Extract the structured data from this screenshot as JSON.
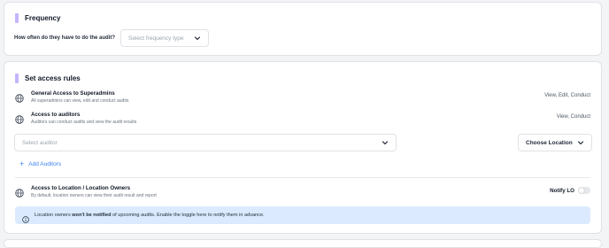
{
  "frequency": {
    "title": "Frequency",
    "question": "How often do they have to do the audit?",
    "select_placeholder": "Select frequency type"
  },
  "access": {
    "title": "Set access rules",
    "rules": [
      {
        "title": "General Access to Superadmins",
        "description": "All superadmins can view, edit and conduct audits",
        "permissions": "View, Edit, Conduct"
      },
      {
        "title": "Access to auditors",
        "description": "Auditors can conduct audits and view the audit results",
        "permissions": "View, Conduct"
      }
    ],
    "auditor_select_placeholder": "Select auditor",
    "location_select_label": "Choose Location",
    "add_auditors_label": "Add Auditors",
    "location_rule": {
      "title": "Access to Location / Location Owners",
      "description": "By default, location owners can view their audit result and report",
      "notify_label": "Notify LO",
      "notify_on": false
    },
    "info": {
      "prefix": "Location owners ",
      "bold": "won't be notified",
      "suffix": " of upcoming audits. Enable the toggle here to notify them in advance."
    }
  },
  "colors": {
    "accent_bar": "#c4b5fd",
    "link_blue": "#3b82f6",
    "info_bg": "#dbeafe"
  },
  "icons": {
    "rule_icon": "globe-icon",
    "info_icon": "info-icon",
    "select_icon": "chevron-down-icon",
    "add_icon": "plus-icon"
  }
}
